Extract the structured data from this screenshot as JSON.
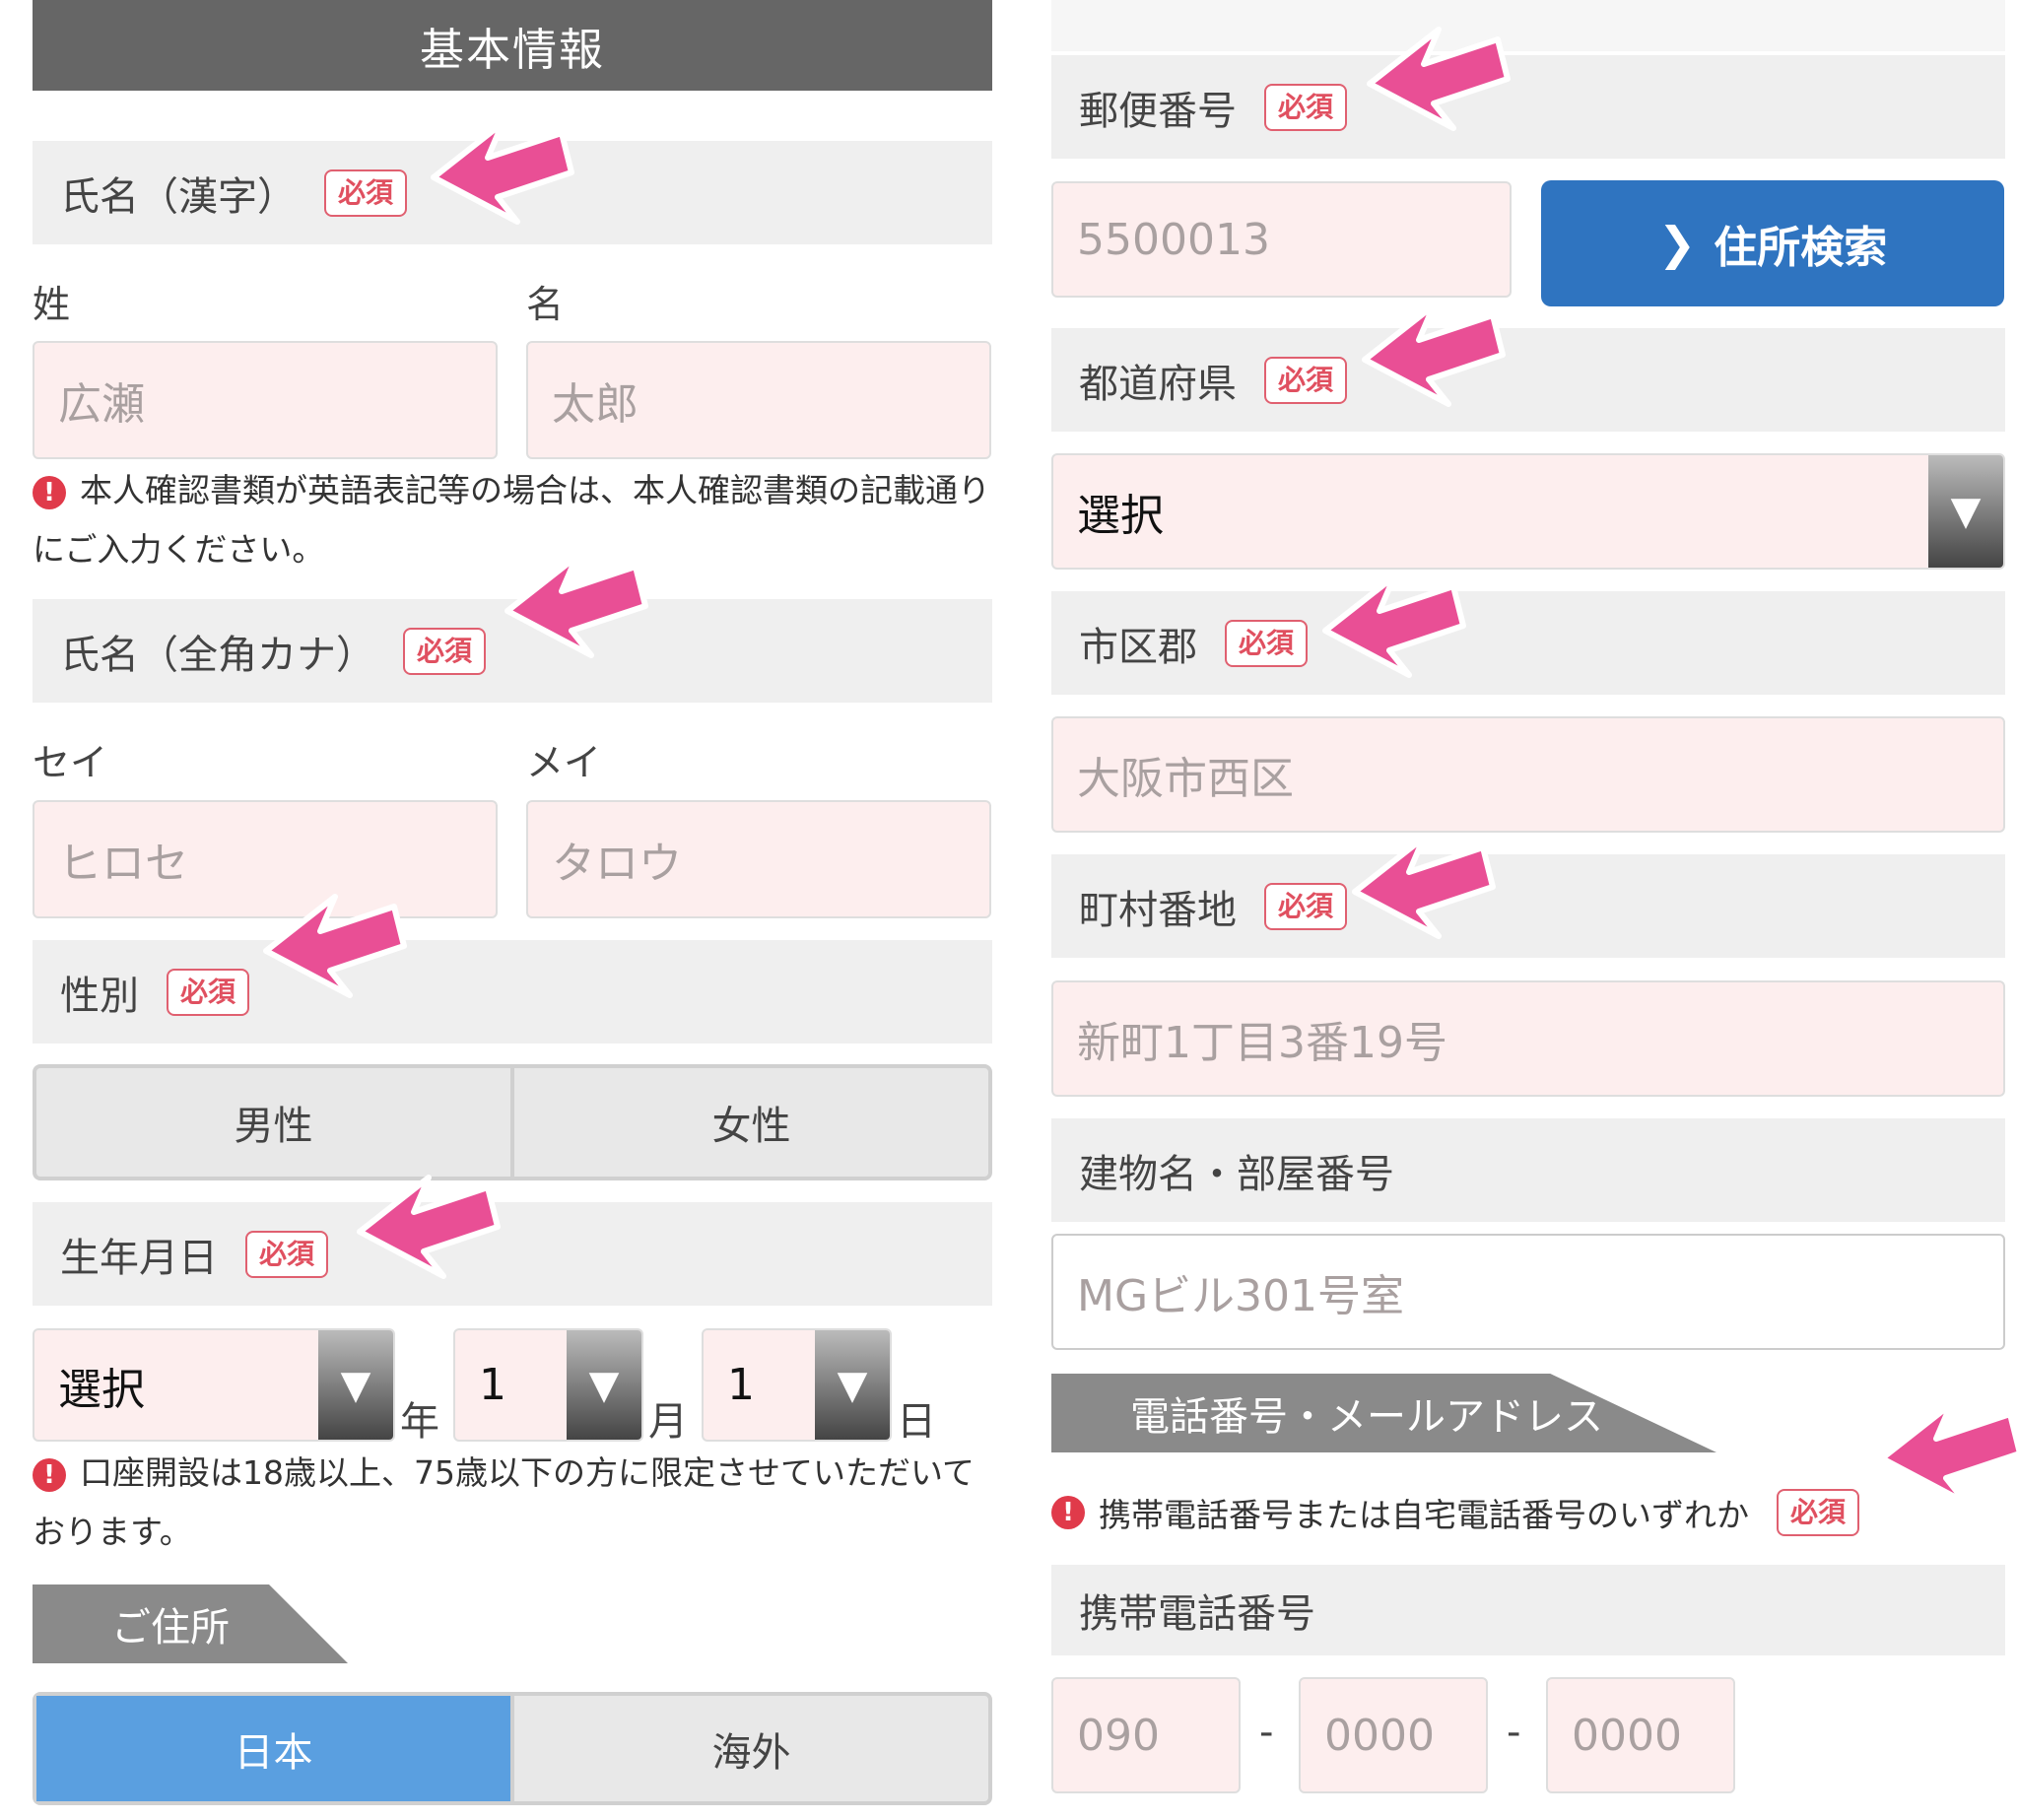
{
  "left": {
    "header": "基本情報",
    "name_kanji": {
      "label": "氏名（漢字）",
      "required": "必須",
      "sei_label": "姓",
      "mei_label": "名",
      "sei_placeholder": "広瀬",
      "mei_placeholder": "太郎"
    },
    "name_note": "本人確認書類が英語表記等の場合は、本人確認書類の記載通りにご入力ください。",
    "name_kana": {
      "label": "氏名（全角カナ）",
      "required": "必須",
      "sei_label": "セイ",
      "mei_label": "メイ",
      "sei_placeholder": "ヒロセ",
      "mei_placeholder": "タロウ"
    },
    "gender": {
      "label": "性別",
      "required": "必須",
      "male": "男性",
      "female": "女性"
    },
    "birthdate": {
      "label": "生年月日",
      "required": "必須",
      "year_value": "選択",
      "year_unit": "年",
      "month_value": "1",
      "month_unit": "月",
      "day_value": "1",
      "day_unit": "日"
    },
    "age_note": "口座開設は18歳以上、75歳以下の方に限定させていただいております。",
    "address_section": "ご住所",
    "country": {
      "japan": "日本",
      "overseas": "海外"
    }
  },
  "right": {
    "postal": {
      "label": "郵便番号",
      "required": "必須",
      "placeholder": "5500013",
      "search_button": "住所検索"
    },
    "prefecture": {
      "label": "都道府県",
      "required": "必須",
      "value": "選択"
    },
    "city": {
      "label": "市区郡",
      "required": "必須",
      "placeholder": "大阪市西区"
    },
    "street": {
      "label": "町村番地",
      "required": "必須",
      "placeholder": "新町1丁目3番19号"
    },
    "building": {
      "label": "建物名・部屋番号",
      "placeholder": "MGビル301号室"
    },
    "contact_section": "電話番号・メールアドレス",
    "phone_note": "携帯電話番号または自宅電話番号のいずれか",
    "phone_required": "必須",
    "mobile": {
      "label": "携帯電話番号",
      "part1": "090",
      "part2": "0000",
      "part3": "0000",
      "sep": "-"
    }
  },
  "colors": {
    "arrow": "#e94f95",
    "accent_blue": "#2f74c0",
    "toggle_active": "#5a9fe0",
    "required": "#e05060"
  },
  "icons": [
    "warning-icon",
    "pointer-arrow-icon",
    "chevron-right-icon",
    "dropdown-arrow-icon"
  ]
}
